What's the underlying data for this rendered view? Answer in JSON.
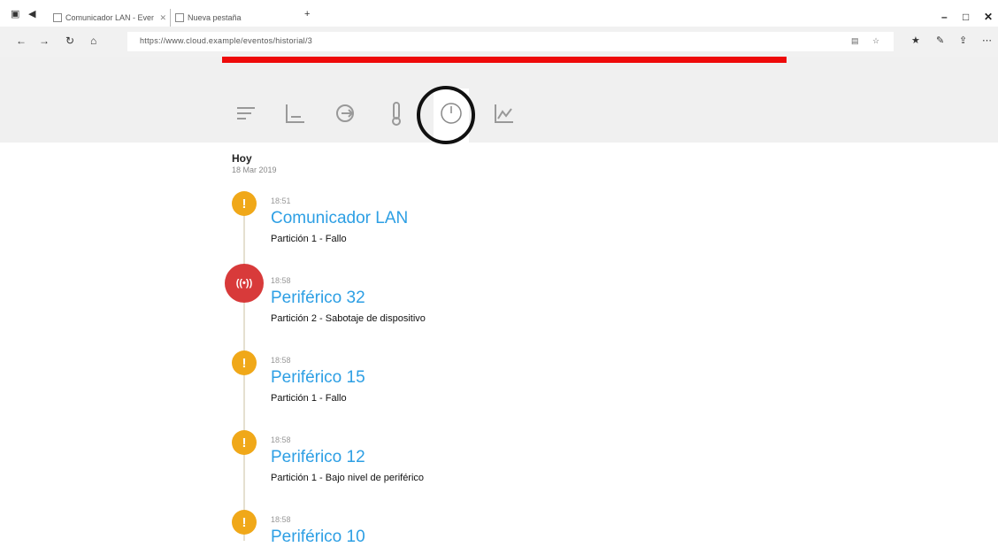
{
  "browser": {
    "tabs": [
      {
        "label": "Comunicador LAN - Eventos"
      },
      {
        "label": "Nueva pestaña"
      }
    ],
    "url": "https://www.cloud.example/eventos/historial/3",
    "progress_color": "#ee0a0a"
  },
  "header": {
    "nav_icons": [
      {
        "name": "list-icon"
      },
      {
        "name": "chart-icon"
      },
      {
        "name": "login-icon"
      },
      {
        "name": "thermometer-icon"
      },
      {
        "name": "clock-icon",
        "active": true
      },
      {
        "name": "area-chart-icon"
      }
    ]
  },
  "timeline": {
    "day_label": "Hoy",
    "day_date": "18 Mar 2019",
    "events": [
      {
        "time": "18:51",
        "title": "Comunicador LAN",
        "desc": "Partición 1 - Fallo",
        "type": "warning",
        "icon": "exclamation-icon"
      },
      {
        "time": "18:58",
        "title": "Periférico 32",
        "desc": "Partición 2 - Sabotaje de dispositivo",
        "type": "alarm",
        "icon": "alarm-icon"
      },
      {
        "time": "18:58",
        "title": "Periférico 15",
        "desc": "Partición 1 - Fallo",
        "type": "warning",
        "icon": "exclamation-icon"
      },
      {
        "time": "18:58",
        "title": "Periférico 12",
        "desc": "Partición 1 - Bajo nivel de periférico",
        "type": "warning",
        "icon": "exclamation-icon"
      },
      {
        "time": "18:58",
        "title": "Periférico 10",
        "desc": "",
        "type": "warning",
        "icon": "exclamation-icon"
      }
    ]
  },
  "colors": {
    "warning": "#f0a819",
    "alarm": "#d83a3a",
    "title_link": "#2d9fe4",
    "header_bg": "#f0f0f0"
  }
}
